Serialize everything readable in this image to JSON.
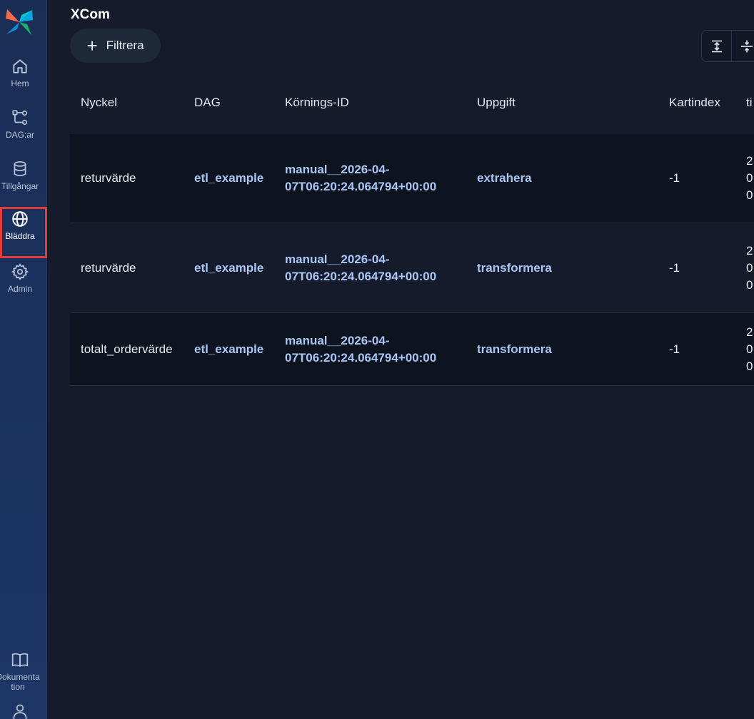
{
  "sidebar": {
    "items": [
      {
        "label": "Hem",
        "icon": "home-icon"
      },
      {
        "label": "DAG:ar",
        "icon": "dag-icon"
      },
      {
        "label": "Tillgångar",
        "icon": "database-icon"
      },
      {
        "label": "Bläddra",
        "icon": "globe-icon",
        "active": true
      },
      {
        "label": "Admin",
        "icon": "gear-icon"
      }
    ],
    "docs_label": "Dokumentation",
    "docs_label_line1": "Dokumenta",
    "docs_label_line2": "tion"
  },
  "page": {
    "title": "XCom",
    "filter_label": "Filtrera"
  },
  "table": {
    "columns": [
      "Nyckel",
      "DAG",
      "Körnings-ID",
      "Uppgift",
      "Kartindex",
      "ti"
    ],
    "rows": [
      {
        "key": "returvärde",
        "dag": "etl_example",
        "run_id_line1": "manual__2026-04-",
        "run_id_line2": "07T06:20:24.064794+00:00",
        "task": "extrahera",
        "map_index": "-1",
        "ts_lines": [
          "2",
          "0",
          "0"
        ]
      },
      {
        "key": "returvärde",
        "dag": "etl_example",
        "run_id_line1": "manual__2026-04-",
        "run_id_line2": "07T06:20:24.064794+00:00",
        "task": "transformera",
        "map_index": "-1",
        "ts_lines": [
          "2",
          "0",
          "0"
        ]
      },
      {
        "key": "totalt_ordervärde",
        "dag": "etl_example",
        "run_id_line1": "manual__2026-04-",
        "run_id_line2": "07T06:20:24.064794+00:00",
        "task": "transformera",
        "map_index": "-1",
        "ts_lines": [
          "2",
          "0",
          "0"
        ]
      }
    ]
  },
  "colors": {
    "accent_link": "#a9c6f5",
    "active_outline": "#e23b3b",
    "sidebar_bg": "#1b3260",
    "page_bg": "#151b2b"
  }
}
